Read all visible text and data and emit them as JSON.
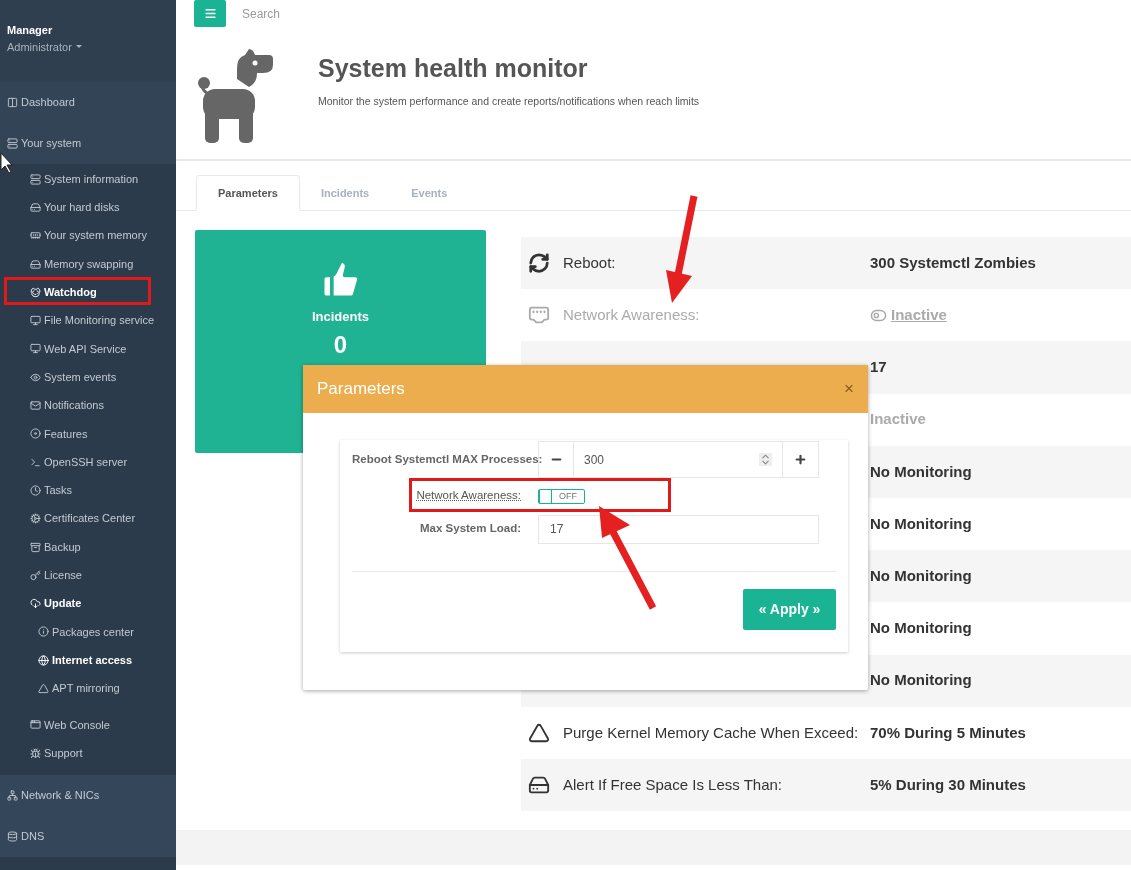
{
  "sidebar": {
    "user": {
      "name": "Manager",
      "role": "Administrator"
    },
    "items": [
      {
        "label": "Dashboard",
        "highlighted": false
      },
      {
        "label": "Your system",
        "highlighted": false,
        "children": [
          {
            "label": "System information",
            "highlighted": false
          },
          {
            "label": "Your hard disks",
            "highlighted": false
          },
          {
            "label": "Your system memory",
            "highlighted": false
          },
          {
            "label": "Memory swapping",
            "highlighted": false
          },
          {
            "label": "Watchdog",
            "highlighted": true
          },
          {
            "label": "File Monitoring service",
            "highlighted": false
          },
          {
            "label": "Web API Service",
            "highlighted": false
          },
          {
            "label": "System events",
            "highlighted": false
          },
          {
            "label": "Notifications",
            "highlighted": false
          },
          {
            "label": "Features",
            "highlighted": false
          },
          {
            "label": "OpenSSH server",
            "highlighted": false
          },
          {
            "label": "Tasks",
            "highlighted": false
          },
          {
            "label": "Certificates Center",
            "highlighted": false
          },
          {
            "label": "Backup",
            "highlighted": false
          },
          {
            "label": "License",
            "highlighted": false
          },
          {
            "label": "Update",
            "highlighted": true,
            "children": [
              {
                "label": "Packages center",
                "highlighted": false
              },
              {
                "label": "Internet access",
                "highlighted": true
              },
              {
                "label": "APT mirroring",
                "highlighted": false
              }
            ]
          },
          {
            "label": "Web Console",
            "highlighted": false
          },
          {
            "label": "Support",
            "highlighted": false
          }
        ]
      },
      {
        "label": "Network & NICs",
        "highlighted": false
      },
      {
        "label": "DNS",
        "highlighted": false
      }
    ]
  },
  "topbar": {
    "search": {
      "placeholder": "Search"
    }
  },
  "header": {
    "title": "System health monitor",
    "subtitle": "Monitor the system performance and create reports/notifications when reach limits"
  },
  "tabs": [
    {
      "label": "Parameters",
      "selected": true
    },
    {
      "label": "Incidents",
      "selected": false
    },
    {
      "label": "Events",
      "selected": false
    }
  ],
  "incidents_card": {
    "label": "Incidents",
    "count": "0"
  },
  "parameters": [
    {
      "kind": "refresh",
      "label": "Reboot:",
      "value": "300 Systemctl Zombies",
      "muted": false
    },
    {
      "kind": "network",
      "label": "Network Awareness:",
      "value": "Inactive",
      "muted": true
    },
    {
      "kind": "hidden",
      "value": "17",
      "muted": false
    },
    {
      "kind": "hidden",
      "value": "Inactive",
      "muted": true
    },
    {
      "kind": "hidden",
      "value": "No Monitoring",
      "muted": false
    },
    {
      "kind": "hidden",
      "value": "No Monitoring",
      "muted": false
    },
    {
      "kind": "hidden",
      "value": "No Monitoring",
      "muted": false
    },
    {
      "kind": "hidden",
      "value": "No Monitoring",
      "muted": false
    },
    {
      "kind": "hidden",
      "value": "No Monitoring",
      "muted": false
    },
    {
      "kind": "linux",
      "label": "Purge Kernel Memory Cache When Exceed:",
      "value": "70% During 5 Minutes",
      "muted": false
    },
    {
      "kind": "disk",
      "label": "Alert If Free Space Is Less Than:",
      "value": "5% During 30 Minutes",
      "muted": false
    }
  ],
  "modal": {
    "title": "Parameters",
    "close": "×",
    "reboot": {
      "label": "Reboot Systemctl MAX Processes:",
      "value": "300"
    },
    "network": {
      "label": "Network Awareness:",
      "on": false,
      "off_text": "OFF"
    },
    "load": {
      "label": "Max System Load:",
      "value": "17"
    },
    "apply": "« Apply »"
  }
}
